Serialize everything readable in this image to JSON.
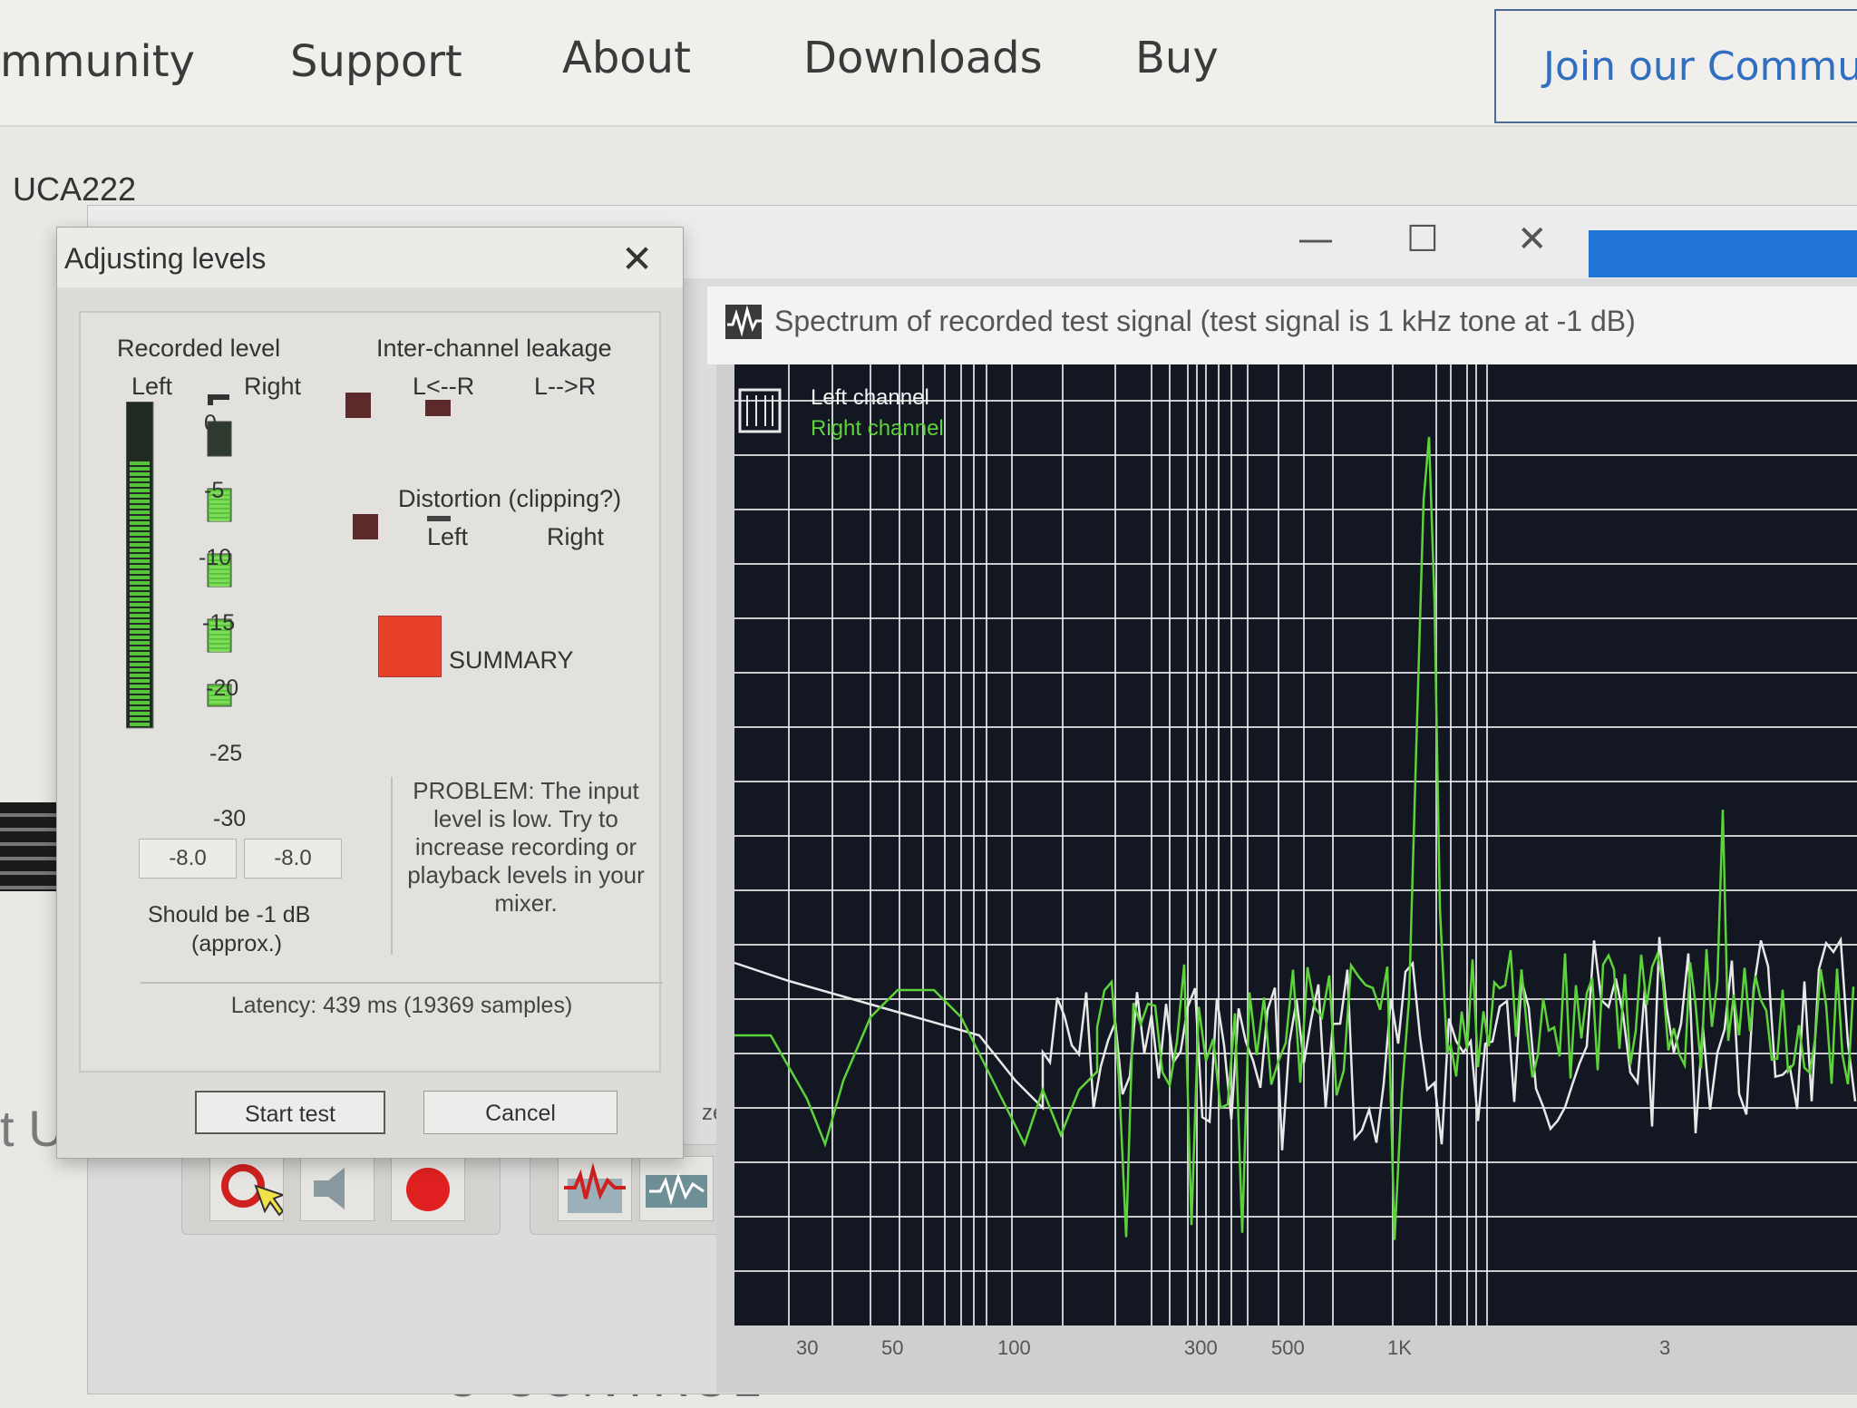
{
  "site": {
    "nav": [
      "mmunity",
      "Support",
      "About",
      "Downloads",
      "Buy"
    ],
    "join_button": "Join our Communit",
    "device": "UCA222",
    "left_text": "t USB",
    "bottom_text": "U-CONTROL"
  },
  "app_window": {
    "controls": {
      "minimize": "—",
      "maximize": "☐",
      "close": "✕"
    },
    "spectrum_title": "Spectrum of recorded test signal (test signal is 1 kHz tone at -1 dB)",
    "legend": {
      "left": "Left channel",
      "right": "Right channel"
    },
    "x_ticks": [
      "30",
      "50",
      "100",
      "300",
      "500",
      "1K",
      "3"
    ],
    "partial_label": "ze",
    "colors": {
      "left": "#e8e8e8",
      "right": "#5dd33a",
      "background": "#121722",
      "grid": "#e9e9e9"
    }
  },
  "dialog": {
    "title": "Adjusting levels",
    "close": "✕",
    "recorded_level": {
      "heading": "Recorded level",
      "left_label": "Left",
      "right_label": "Right",
      "scale": [
        "0",
        "-5",
        "-10",
        "-15",
        "-20",
        "-25",
        "-30"
      ],
      "left_value": "-8.0",
      "right_value": "-8.0",
      "note_line1": "Should be  -1 dB",
      "note_line2": "(approx.)"
    },
    "leakage": {
      "heading": "Inter-channel leakage",
      "l_from_r": "L<--R",
      "l_to_r": "L-->R"
    },
    "distortion": {
      "heading": "Distortion (clipping?)",
      "left": "Left",
      "right": "Right"
    },
    "summary": {
      "label": "SUMMARY",
      "color": "#e8412a"
    },
    "problem_text": "PROBLEM: The input level is low. Try to increase recording or playback levels in your mixer.",
    "latency": "Latency: 439 ms (19369 samples)",
    "buttons": {
      "start": "Start test",
      "cancel": "Cancel"
    }
  }
}
